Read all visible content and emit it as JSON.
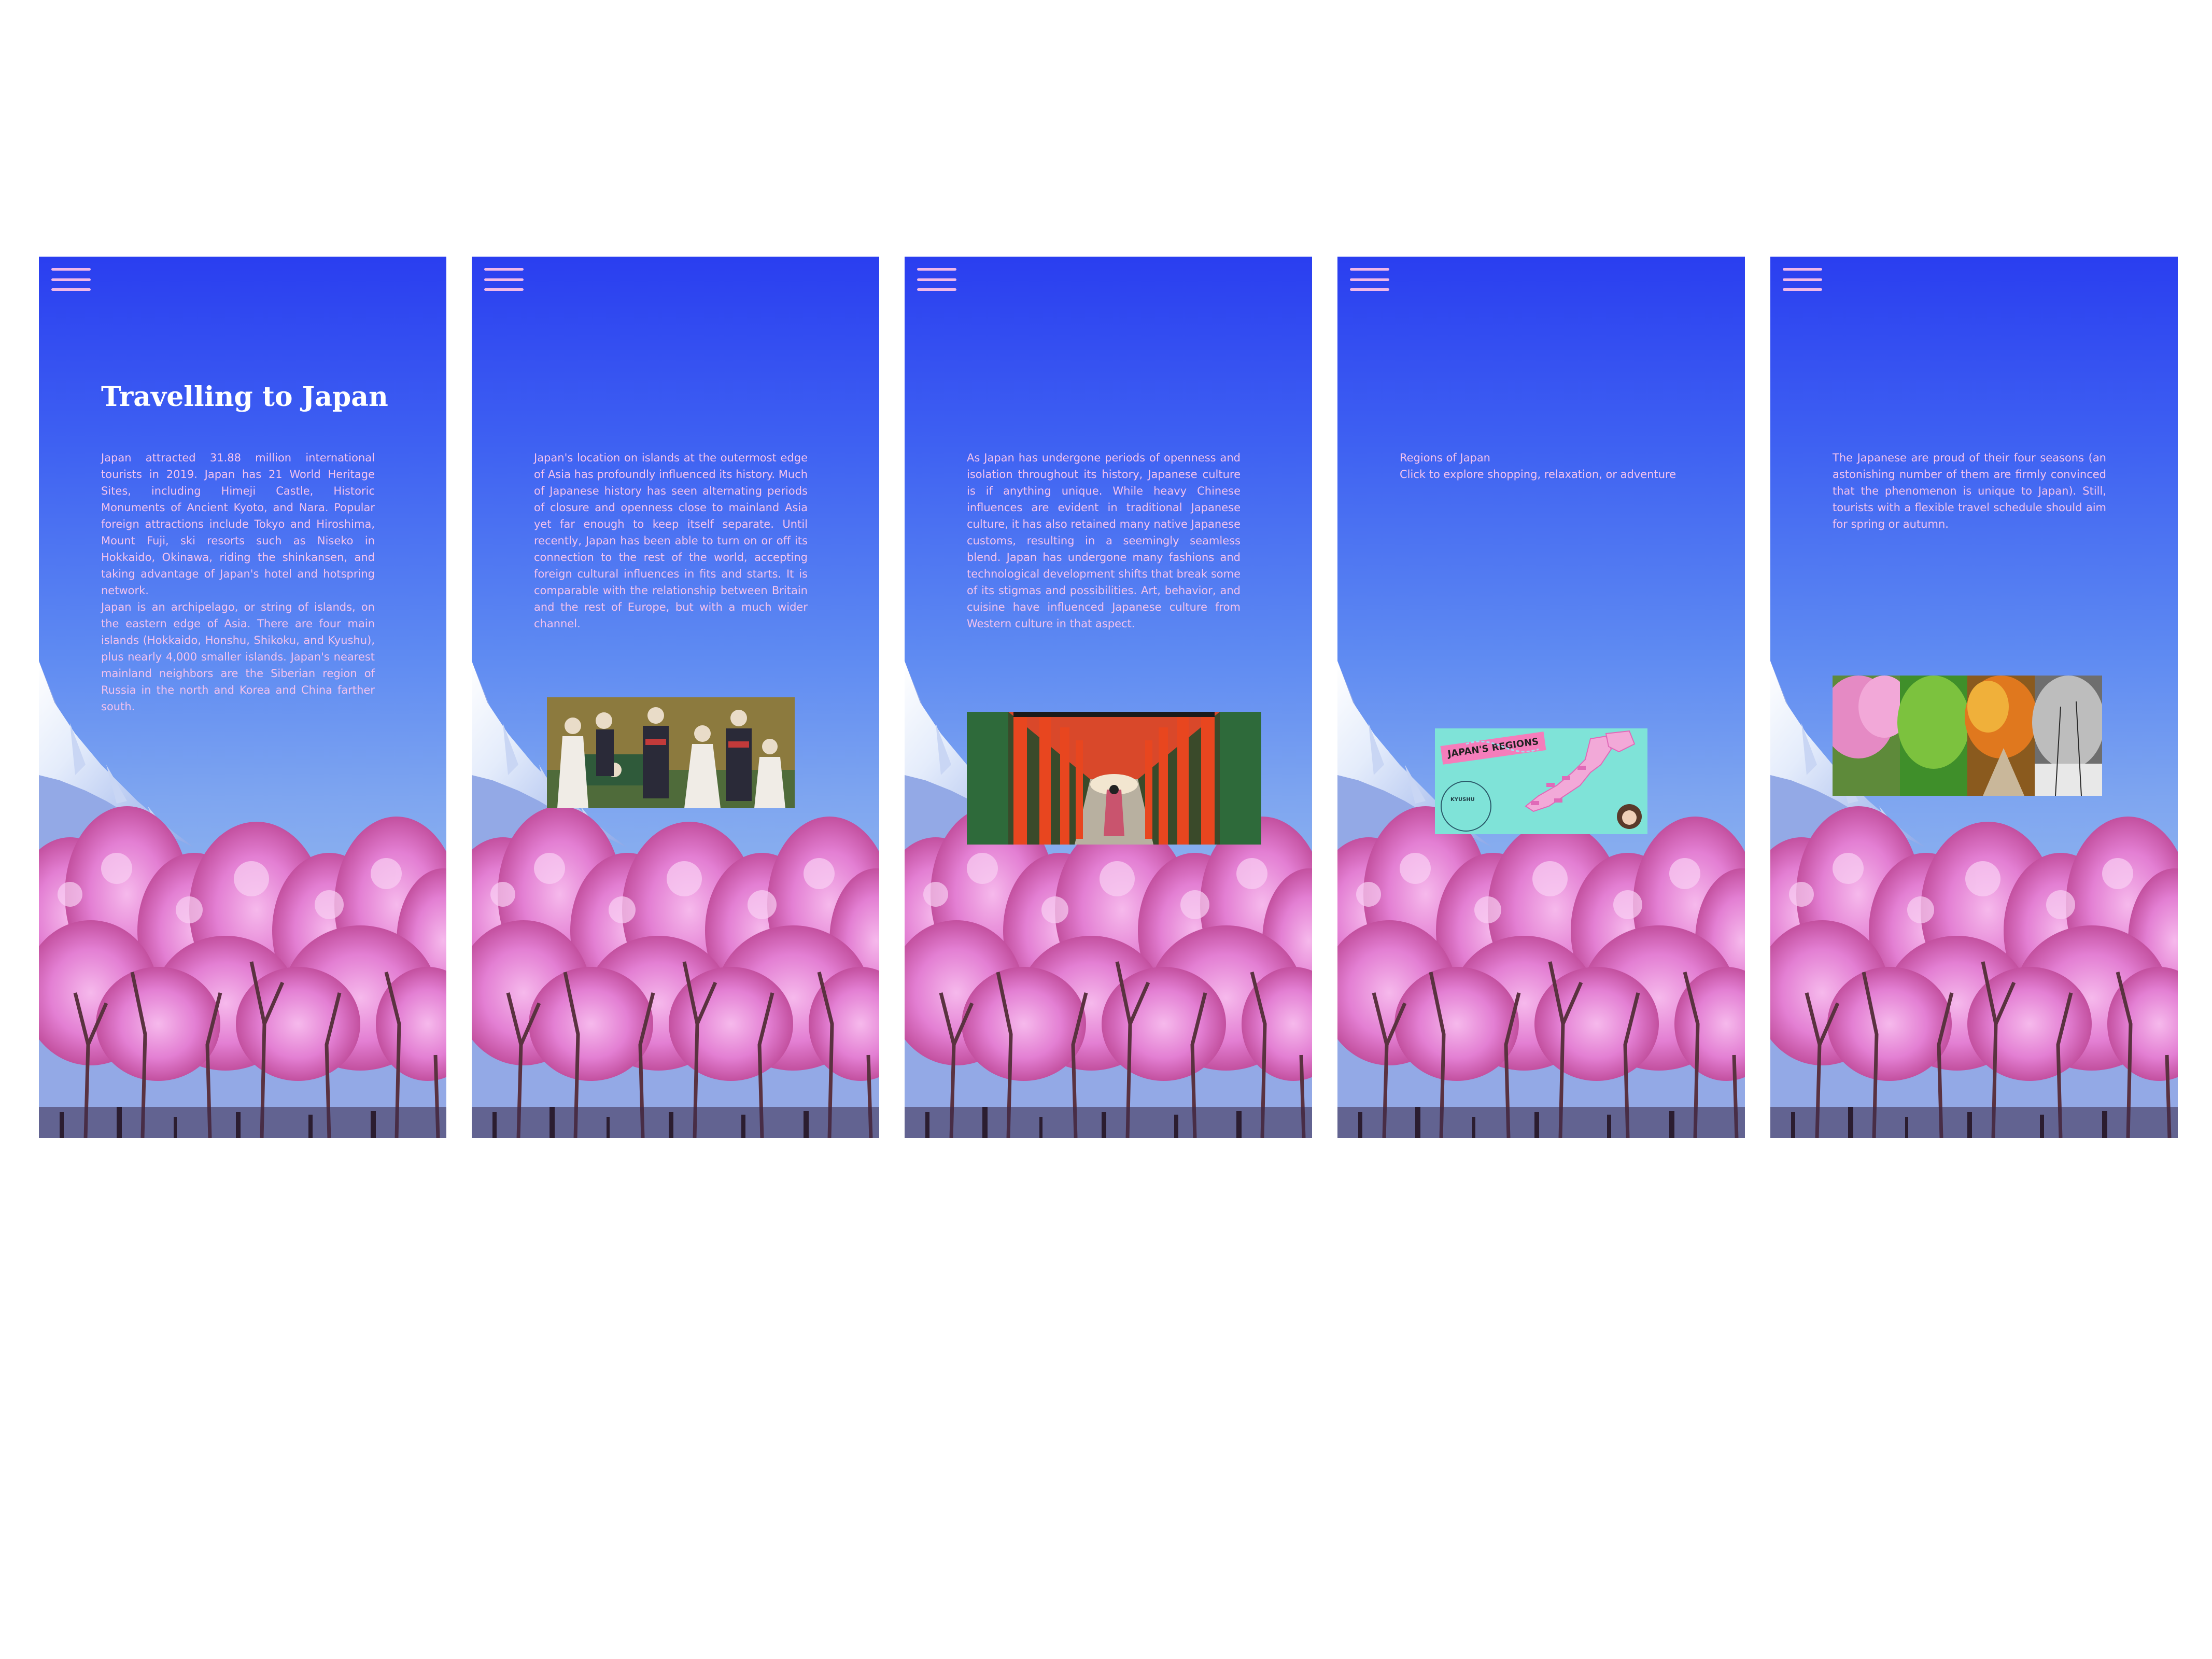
{
  "screens": [
    {
      "menu_icon": "hamburger-menu-icon",
      "title": "Travelling to Japan",
      "paragraphs": [
        "Japan attracted 31.88 million international tourists in 2019. Japan has 21 World Heritage Sites, including Himeji Castle, Historic Monuments of Ancient Kyoto, and Nara. Popular foreign attractions include Tokyo and Hiroshima, Mount Fuji, ski resorts such as Niseko in Hokkaido, Okinawa, riding the shinkansen, and taking advantage of Japan's hotel and hotspring network.",
        "Japan is an archipelago, or string of islands, on the eastern edge of Asia. There are four main islands (Hokkaido, Honshu, Shikoku, and Kyushu), plus nearly 4,000 smaller islands. Japan's nearest mainland neighbors are the Siberian region of Russia in the north and Korea and China farther south."
      ]
    },
    {
      "menu_icon": "hamburger-menu-icon",
      "paragraphs": [
        "Japan's location on islands at the outermost edge of Asia has profoundly influenced its history. Much of Japanese history has seen alternating periods of closure and openness close to mainland Asia yet far enough to keep itself separate. Until recently, Japan has been able to turn on or off its connection to the rest of the world, accepting foreign cultural influences in fits and starts. It is comparable with the relationship between Britain and the rest of Europe, but with a much wider channel."
      ],
      "image": "historical-family-photo"
    },
    {
      "menu_icon": "hamburger-menu-icon",
      "paragraphs": [
        "As Japan has undergone periods of openness and isolation throughout its history, Japanese culture is if anything unique. While heavy Chinese influences are evident in traditional Japanese culture, it has also retained many native Japanese customs, resulting in a seemingly seamless blend. Japan has undergone many fashions and technological development shifts that break some of its stigmas and possibilities. Art, behavior, and cuisine have influenced Japanese culture from Western culture in that aspect."
      ],
      "image": "torii-gates-photo"
    },
    {
      "menu_icon": "hamburger-menu-icon",
      "heading": "Regions of Japan",
      "subheading": "Click to explore shopping, relaxation, or adventure",
      "map_title": "JAPAN'S REGIONS",
      "map_callout": "KYUSHU",
      "image": "japan-regions-map"
    },
    {
      "menu_icon": "hamburger-menu-icon",
      "paragraphs": [
        "The Japanese are proud of their four seasons (an astonishing number of them are firmly convinced that the phenomenon is unique to Japan). Still, tourists with a flexible travel schedule should aim for spring or autumn."
      ],
      "image": "four-seasons-photo"
    }
  ],
  "colors": {
    "sky_top": "#2a3ef0",
    "sky_bottom": "#8db2ee",
    "text_pink": "#f4c2ee",
    "blossom": "#e07ad0",
    "map_teal": "#7fe3d8"
  }
}
